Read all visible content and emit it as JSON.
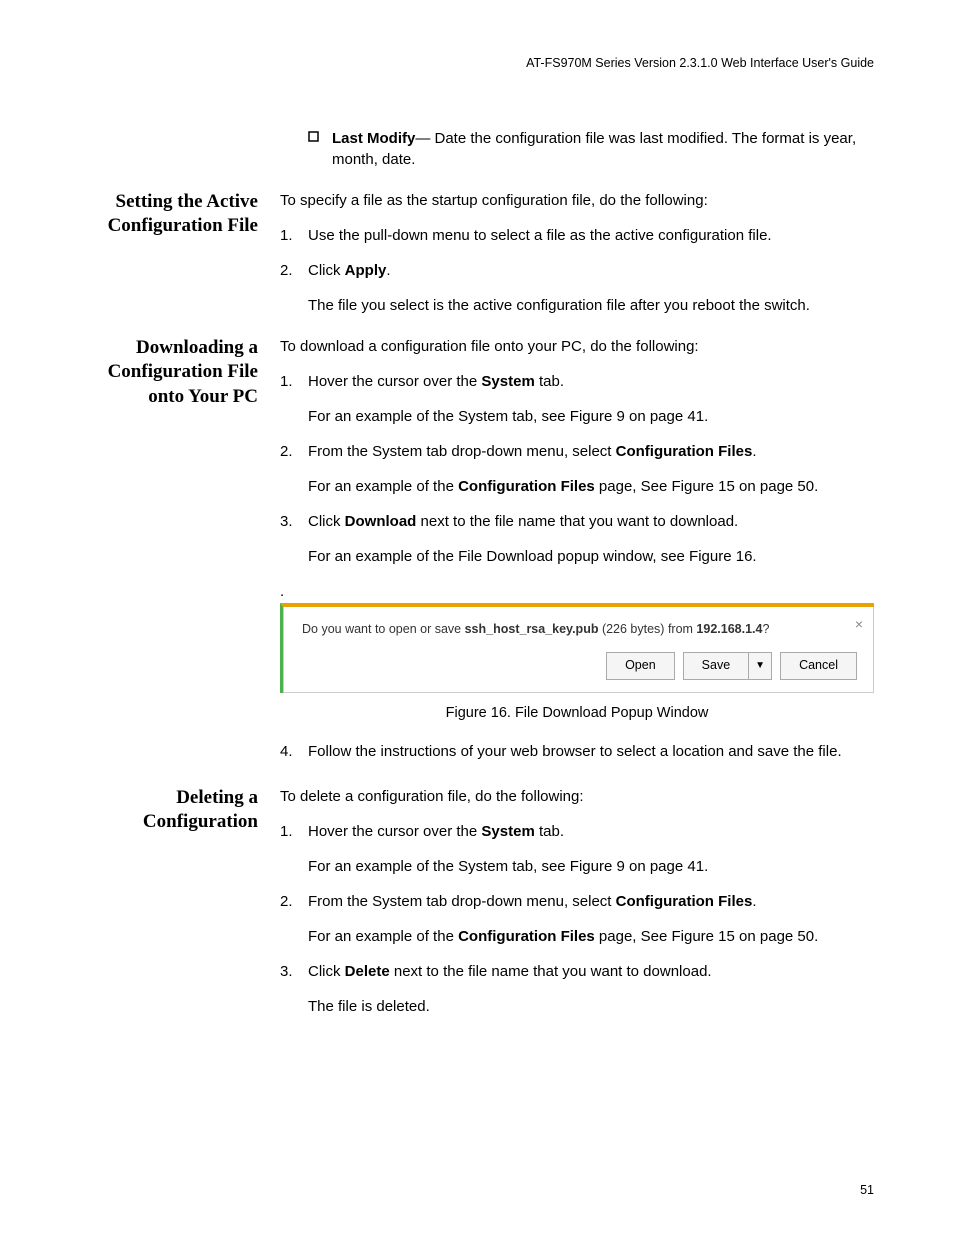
{
  "header": "AT-FS970M Series Version 2.3.1.0 Web Interface User's Guide",
  "top_bullet": {
    "label": "Last Modify",
    "text": "— Date the configuration file was last modified. The format is year, month, date."
  },
  "sections": {
    "setting": {
      "heading": "Setting the Active Configuration File",
      "intro": "To specify a file as the startup configuration file, do the following:",
      "step1": "Use the pull-down menu to select a file as the active configuration file.",
      "step2_pre": "Click ",
      "step2_bold": "Apply",
      "step2_post": ".",
      "step2_note": "The file you select is the active configuration file after you reboot the switch."
    },
    "downloading": {
      "heading": "Downloading a Configuration File onto Your PC",
      "intro": "To download a configuration file onto your PC, do the following:",
      "step1_pre": "Hover the cursor over the ",
      "step1_bold": "System",
      "step1_post": " tab.",
      "step1_note": "For an example of the System tab, see Figure 9 on page 41.",
      "step2_pre": "From the System tab drop-down menu, select ",
      "step2_bold": "Configuration Files",
      "step2_post": ".",
      "step2_note_pre": "For an example of the ",
      "step2_note_bold": "Configuration Files",
      "step2_note_post": " page, See Figure 15 on page 50.",
      "step3_pre": "Click ",
      "step3_bold": "Download",
      "step3_post": " next to the file name that you want to download.",
      "step3_note": "For an example of the File Download popup window, see Figure 16.",
      "step4": "Follow the instructions of your web browser to select a location and save the file."
    },
    "deleting": {
      "heading": "Deleting a Configuration",
      "intro": "To delete a configuration file, do the following:",
      "step1_pre": "Hover the cursor over the ",
      "step1_bold": "System",
      "step1_post": " tab.",
      "step1_note": "For an example of the System tab, see Figure 9 on page 41.",
      "step2_pre": "From the System tab drop-down menu, select ",
      "step2_bold": "Configuration Files",
      "step2_post": ".",
      "step2_note_pre": "For an example of the ",
      "step2_note_bold": "Configuration Files",
      "step2_note_post": " page, See Figure 15 on page 50.",
      "step3_pre": "Click ",
      "step3_bold": "Delete",
      "step3_post": " next to the file name that you want to download.",
      "step3_note": "The file is deleted."
    }
  },
  "popup": {
    "prompt_pre": "Do you want to open or save ",
    "prompt_file": "ssh_host_rsa_key.pub",
    "prompt_mid": " (226 bytes) from ",
    "prompt_host": "192.168.1.4",
    "prompt_post": "?",
    "open": "Open",
    "save": "Save",
    "cancel": "Cancel"
  },
  "figure_caption": "Figure 16. File Download Popup Window",
  "page_number": "51",
  "period": "."
}
